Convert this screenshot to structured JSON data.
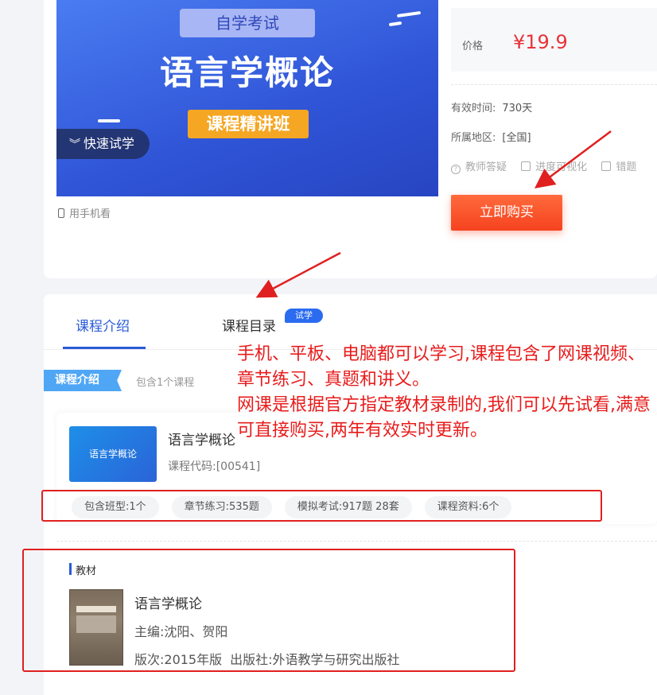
{
  "banner": {
    "tag": "自学考试",
    "title": "语言学概论",
    "subtitle": "课程精讲班",
    "try_label": "快速试学"
  },
  "mobile_link": "用手机看",
  "price": {
    "label": "价格",
    "value": "¥19.9"
  },
  "info": {
    "validity_label": "有效时间:",
    "validity_value": "730天",
    "region_label": "所属地区:",
    "region_value": "[全国]"
  },
  "features": [
    "教师答疑",
    "进度可视化",
    "错题"
  ],
  "buy_button": "立即购买",
  "tabs": {
    "intro": "课程介绍",
    "catalog": "课程目录",
    "badge": "试学"
  },
  "section": {
    "tag": "课程介绍",
    "note": "包含1个课程"
  },
  "course": {
    "thumb_text": "语言学概论",
    "title": "语言学概论",
    "code": "课程代码:[00541]",
    "stats": [
      "包含班型:1个",
      "章节练习:535题",
      "模拟考试:917题 28套",
      "课程资料:6个"
    ]
  },
  "book": {
    "tag": "教材",
    "title": "语言学概论",
    "editor": "主编:沈阳、贺阳",
    "edition": "版次:2015年版",
    "publisher": "出版社:外语教学与研究出版社"
  },
  "annotation": {
    "line1": "手机、平板、电脑都可以学习,课程包含了网课视频、章节练习、真题和讲义。",
    "line2": "网课是根据官方指定教材录制的,我们可以先试看,满意可直接购买,两年有效实时更新。"
  },
  "colors": {
    "accent": "#2a5bd7",
    "price": "#e8333a",
    "buy": "#f5431f",
    "annotation": "#e81c1c"
  }
}
